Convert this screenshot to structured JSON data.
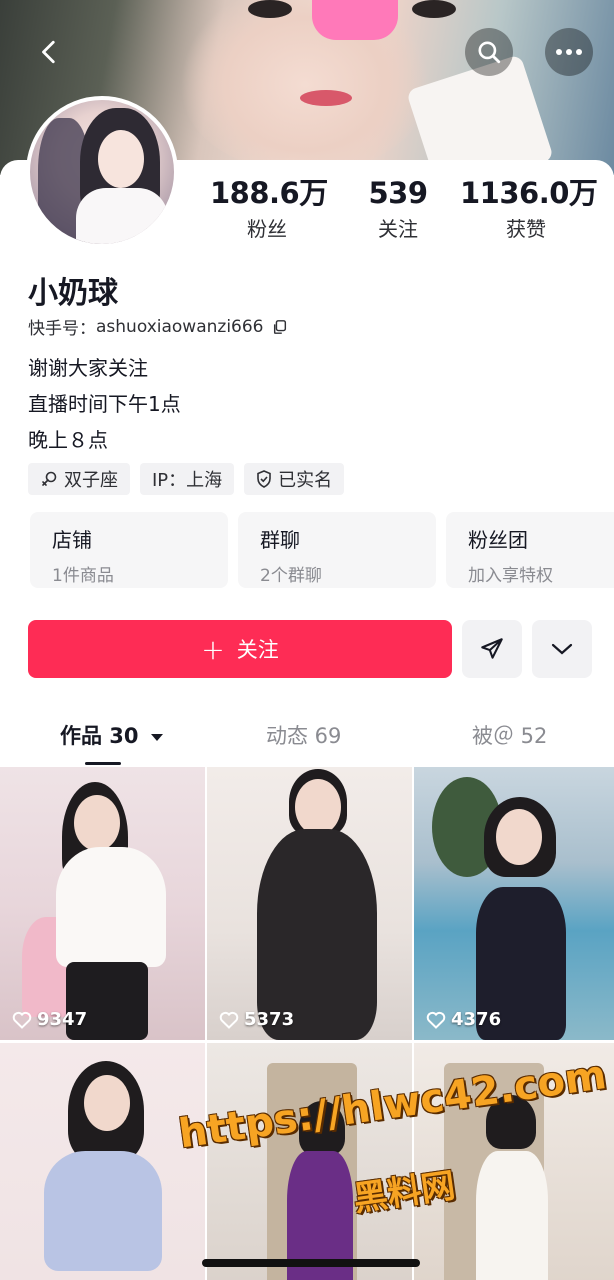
{
  "profile": {
    "name": "小奶球",
    "uid_label": "快手号：",
    "uid": "ashuoxiaowanzi666",
    "bio": [
      "谢谢大家关注",
      "直播时间下午1点",
      "晚上８点"
    ]
  },
  "stats": [
    {
      "num": "188.6万",
      "label": "粉丝"
    },
    {
      "num": "539",
      "label": "关注"
    },
    {
      "num": "1136.0万",
      "label": "获赞"
    }
  ],
  "tags": [
    "双子座",
    "IP：上海",
    "已实名"
  ],
  "info_cards": [
    {
      "title": "店铺",
      "sub": "1件商品"
    },
    {
      "title": "群聊",
      "sub": "2个群聊"
    },
    {
      "title": "粉丝团",
      "sub": "加入享特权"
    }
  ],
  "actions": {
    "follow_plus": "+",
    "follow_label": "关注"
  },
  "tabs": [
    {
      "label": "作品 30",
      "active": true
    },
    {
      "label": "动态 69",
      "active": false
    },
    {
      "label": "被＠ 52",
      "active": false
    }
  ],
  "videos": [
    {
      "likes": "9347"
    },
    {
      "likes": "5373"
    },
    {
      "likes": "4376"
    },
    {
      "likes": ""
    },
    {
      "likes": ""
    },
    {
      "likes": ""
    }
  ],
  "watermark": {
    "url": "https://hlwc42.com",
    "name": "黑料网"
  },
  "colors": {
    "accent": "#fe2c55",
    "watermark": "#f7a423"
  },
  "icons": [
    "back-arrow-icon",
    "search-icon",
    "more-icon",
    "copy-icon",
    "zodiac-icon",
    "shield-check-icon",
    "share-icon",
    "chevron-down-icon",
    "heart-icon",
    "caret-down-icon"
  ]
}
